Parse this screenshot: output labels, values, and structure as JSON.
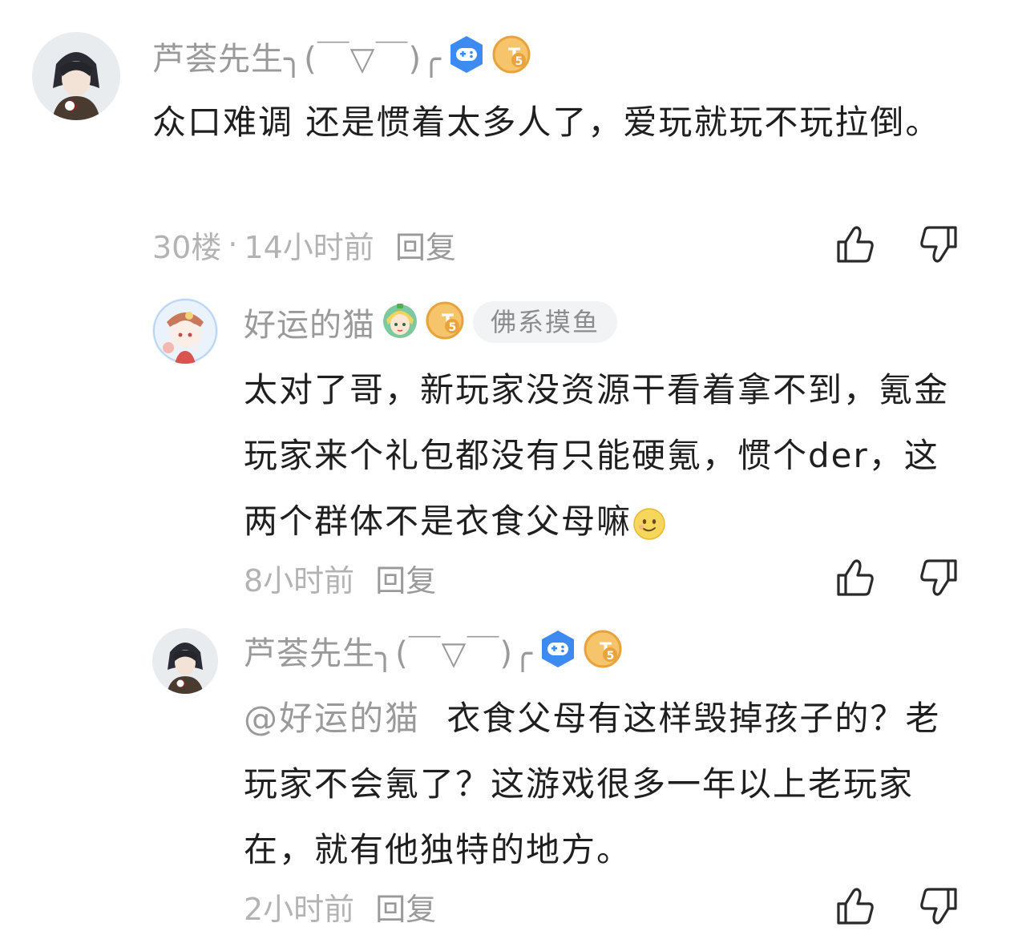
{
  "comments": [
    {
      "author": "芦荟先生╮(￣▽￣)╭",
      "content": "众口难调 还是惯着太多人了，爱玩就玩不玩拉倒。",
      "floor": "30楼",
      "separator": "·",
      "time": "14小时前",
      "reply_label": "回复",
      "badges": [
        "gamepad-badge-icon",
        "t5-level-badge-icon"
      ]
    },
    {
      "author": "好运的猫",
      "tag": "佛系摸鱼",
      "content": "太对了哥，新玩家没资源干看着拿不到，氪金玩家来个礼包都没有只能硬氪，惯个der，这两个群体不是衣食父母嘛",
      "emoji": "slight-smile-emoji-icon",
      "time": "8小时前",
      "reply_label": "回复",
      "badges": [
        "character-badge-icon",
        "t5-level-badge-icon"
      ]
    },
    {
      "author": "芦荟先生╮(￣▽￣)╭",
      "mention": "@好运的猫",
      "content": "衣食父母有这样毁掉孩子的？老玩家不会氪了？这游戏很多一年以上老玩家在，就有他独特的地方。",
      "time": "2小时前",
      "reply_label": "回复",
      "badges": [
        "gamepad-badge-icon",
        "t5-level-badge-icon"
      ]
    }
  ],
  "level_badge_text": "T5",
  "colors": {
    "text_primary": "#1f1f1f",
    "text_secondary": "#9a9a9a",
    "badge_blue": "#3d8bf0",
    "badge_gold": "#e8a33c"
  }
}
